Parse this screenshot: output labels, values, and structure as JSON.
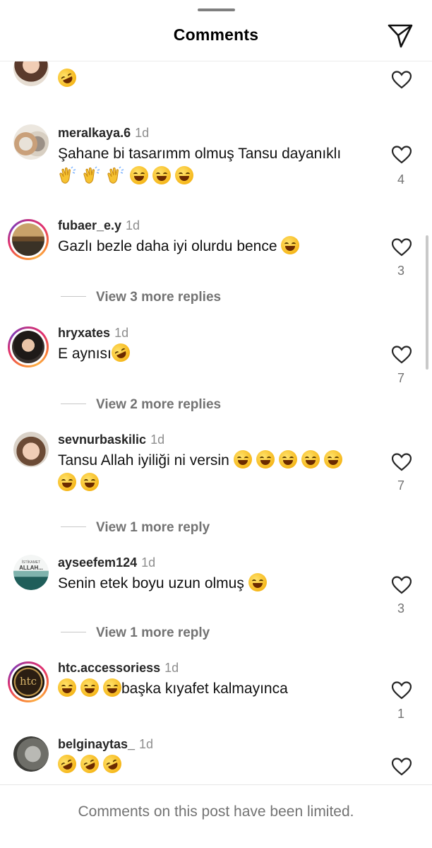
{
  "header": {
    "title": "Comments",
    "share_icon": "send-icon"
  },
  "comments": [
    {
      "username": "",
      "time": "",
      "text": "",
      "emojis": [
        "rofl"
      ],
      "likes": ""
    },
    {
      "username": "meralkaya.6",
      "time": "1d",
      "text": "Şahane bi tasarımm olmuş Tansu dayanıklı",
      "emojis": [
        "clap",
        "clap",
        "clap",
        "joy",
        "joy",
        "joy"
      ],
      "likes": "4"
    },
    {
      "username": "fubaer_e.y",
      "time": "1d",
      "text": "Gazlı bezle daha iyi olurdu bence",
      "emojis": [
        "joy"
      ],
      "likes": "3",
      "replies": "View 3 more replies"
    },
    {
      "username": "hryxates",
      "time": "1d",
      "text": "E aynısı",
      "emojis": [
        "rofl"
      ],
      "likes": "7",
      "replies": "View 2 more replies"
    },
    {
      "username": "sevnurbaskilic",
      "time": "1d",
      "text": "Tansu Allah iyiliği ni versin",
      "emojis": [
        "joy",
        "joy",
        "joy",
        "joy",
        "joy",
        "joy",
        "joy"
      ],
      "likes": "7",
      "replies": "View 1 more reply"
    },
    {
      "username": "ayseefem124",
      "time": "1d",
      "text": "Senin etek boyu uzun olmuş",
      "emojis": [
        "sweat-smile"
      ],
      "likes": "3",
      "replies": "View 1 more reply",
      "avatar_text": [
        "İSTİKAMET",
        "ALLAH..."
      ]
    },
    {
      "username": "htc.accessoriess",
      "time": "1d",
      "text": "başka kıyafet kalmayınca",
      "emojis": [
        "joy",
        "joy",
        "joy"
      ],
      "likes": "1",
      "avatar_text": [
        "htc"
      ]
    },
    {
      "username": "belginaytas_",
      "time": "1d",
      "text": "",
      "emojis": [
        "rofl",
        "rofl",
        "rofl"
      ],
      "likes": ""
    }
  ],
  "footer": {
    "text": "Comments on this post have been limited."
  },
  "colors": {
    "ring_start": "#c13584",
    "ring_end": "#fcaf45",
    "muted": "#737373"
  }
}
